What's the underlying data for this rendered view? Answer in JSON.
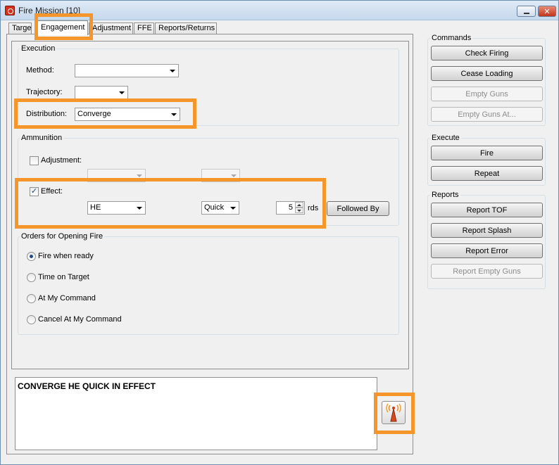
{
  "window": {
    "title": "Fire Mission [10]"
  },
  "tabs": [
    {
      "label": "Target"
    },
    {
      "label": "Engagement"
    },
    {
      "label": "Adjustment"
    },
    {
      "label": "FFE"
    },
    {
      "label": "Reports/Returns"
    }
  ],
  "active_tab": "Engagement",
  "execution": {
    "group_label": "Execution",
    "method_label": "Method:",
    "method_value": "",
    "trajectory_label": "Trajectory:",
    "trajectory_value": "",
    "distribution_label": "Distribution:",
    "distribution_value": "Converge"
  },
  "ammunition": {
    "group_label": "Ammunition",
    "adjustment_label": "Adjustment:",
    "adjustment_checked": false,
    "effect_label": "Effect:",
    "effect_checked": true,
    "effect_round_type": "HE",
    "effect_fuze": "Quick",
    "effect_rounds": "5",
    "rounds_unit": "rds",
    "followed_by_label": "Followed By"
  },
  "orders": {
    "group_label": "Orders for Opening Fire",
    "options": [
      {
        "label": "Fire when ready",
        "checked": true
      },
      {
        "label": "Time on Target",
        "checked": false
      },
      {
        "label": "At My Command",
        "checked": false
      },
      {
        "label": "Cancel At My Command",
        "checked": false
      }
    ]
  },
  "output_text": "CONVERGE HE QUICK IN EFFECT",
  "commands": {
    "group_label": "Commands",
    "buttons": [
      {
        "label": "Check Firing",
        "enabled": true
      },
      {
        "label": "Cease Loading",
        "enabled": true
      },
      {
        "label": "Empty Guns",
        "enabled": false
      },
      {
        "label": "Empty Guns At...",
        "enabled": false
      }
    ]
  },
  "execute": {
    "group_label": "Execute",
    "buttons": [
      {
        "label": "Fire",
        "enabled": true
      },
      {
        "label": "Repeat",
        "enabled": true
      }
    ]
  },
  "reports": {
    "group_label": "Reports",
    "buttons": [
      {
        "label": "Report TOF",
        "enabled": true
      },
      {
        "label": "Report Splash",
        "enabled": true
      },
      {
        "label": "Report Error",
        "enabled": true
      },
      {
        "label": "Report Empty Guns",
        "enabled": false
      }
    ]
  },
  "icons": {
    "app": "fire-mission-app-icon",
    "broadcast": "radio-tower-broadcast-icon"
  },
  "colors": {
    "highlight": "#f5962c",
    "accent": "#234b86"
  }
}
